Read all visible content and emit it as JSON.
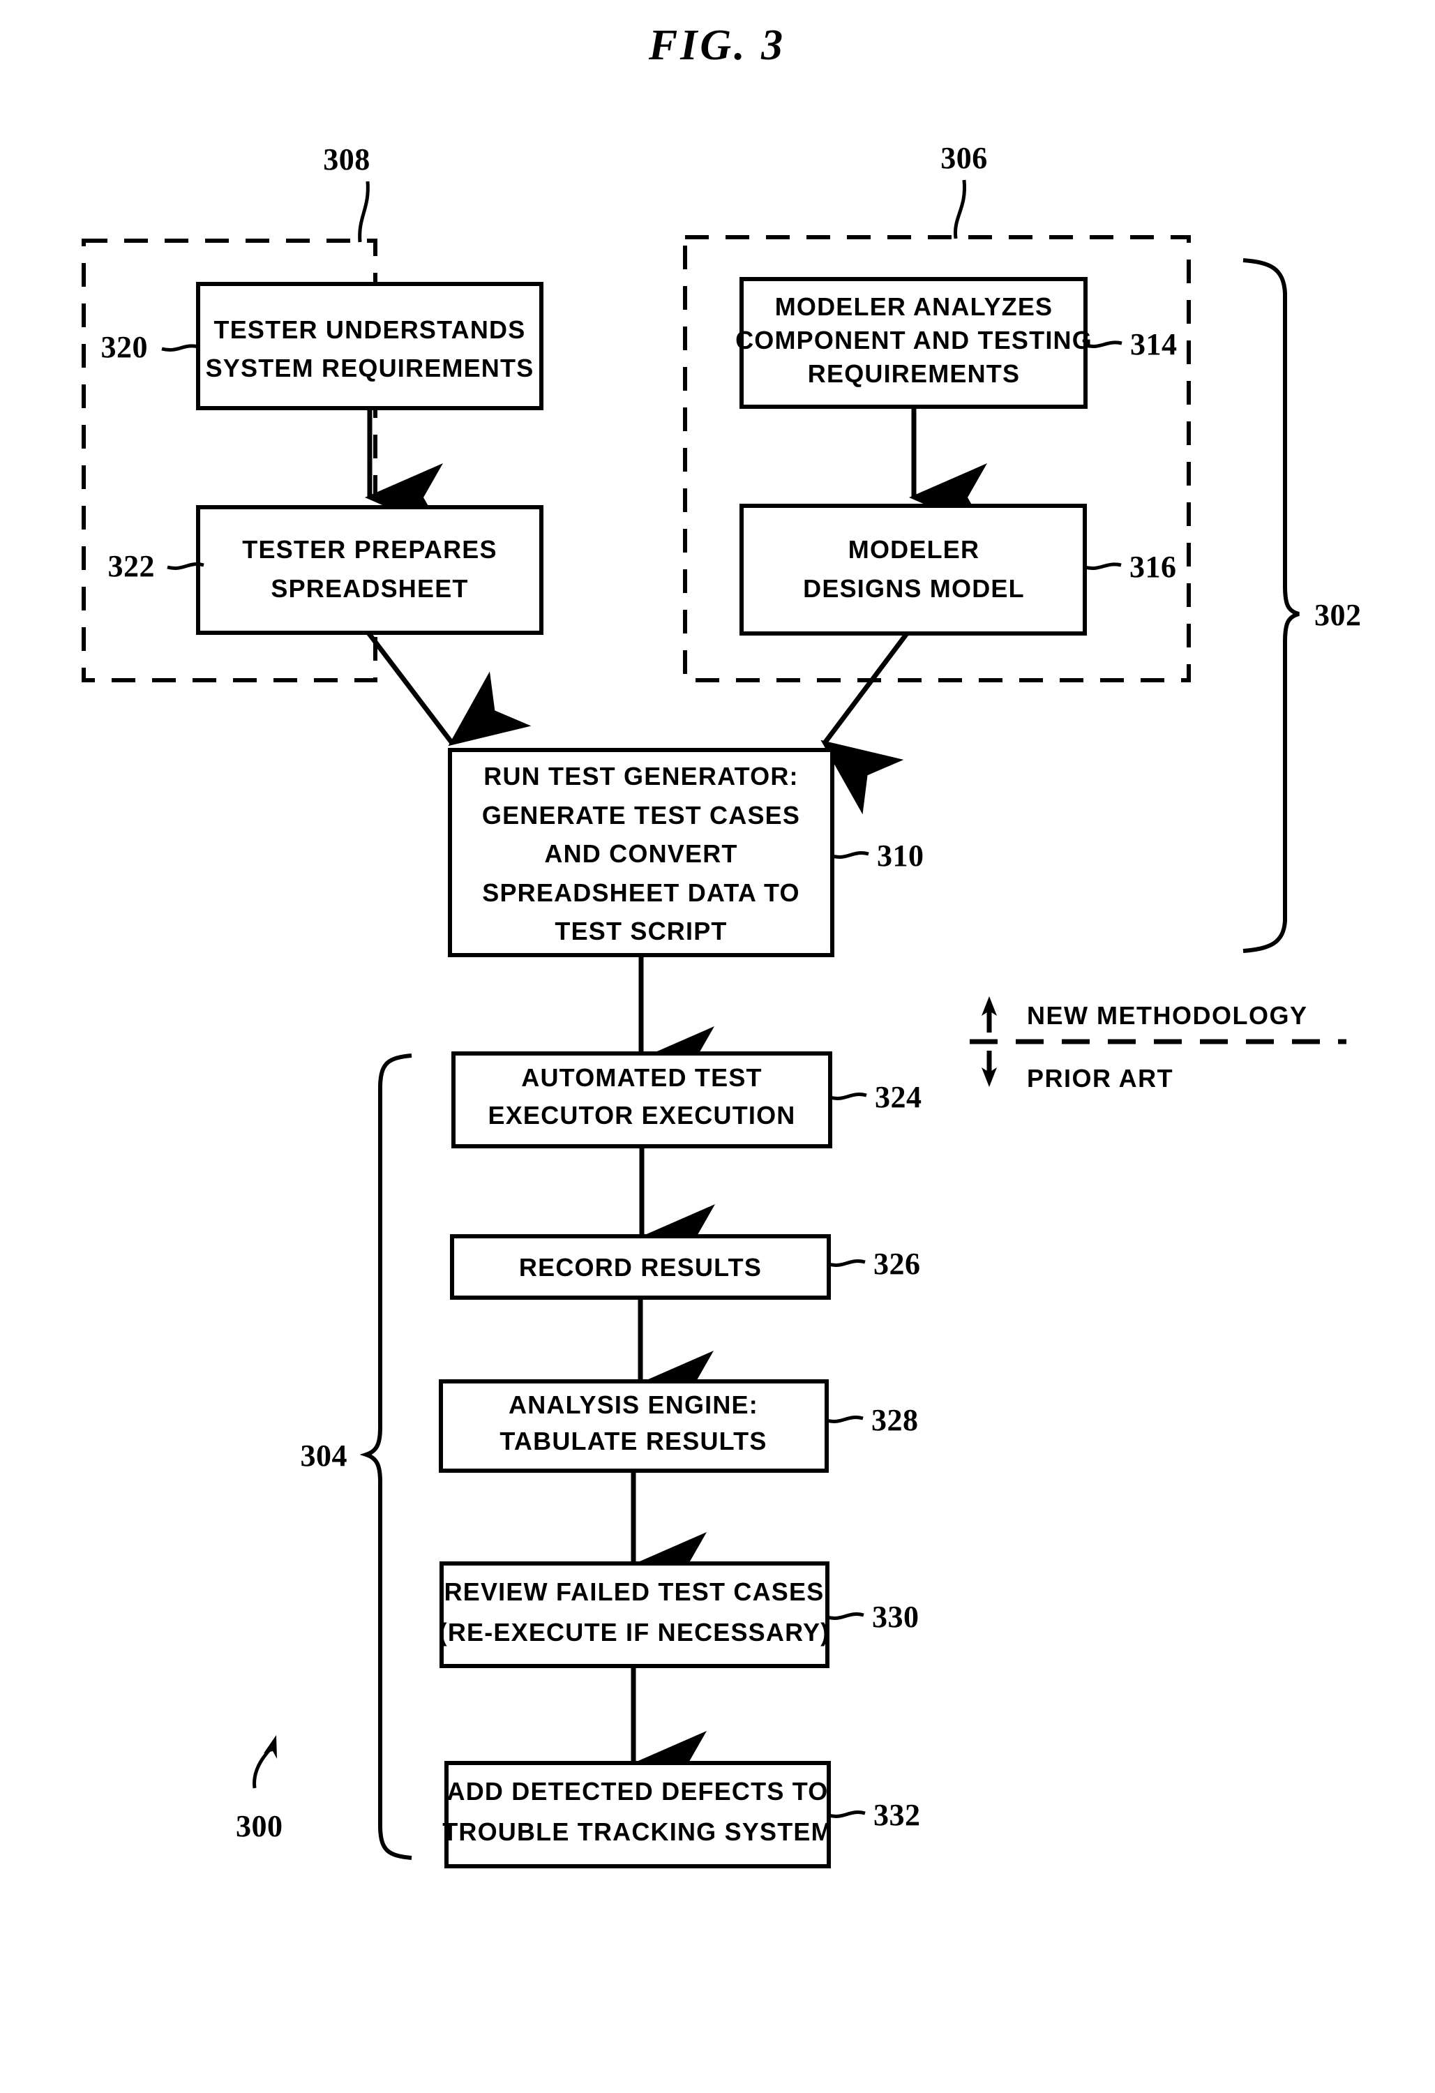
{
  "figure": {
    "title": "FIG.  3",
    "root_reference": "300"
  },
  "groups": [
    {
      "id": "tester-group",
      "reference": "308",
      "name": "tester-dashed-group"
    },
    {
      "id": "modeler-group",
      "reference": "306",
      "name": "modeler-dashed-group"
    }
  ],
  "braces": [
    {
      "id": "brace-302",
      "reference": "302",
      "name": "new-methodology-brace"
    },
    {
      "id": "brace-304",
      "reference": "304",
      "name": "prior-art-brace"
    }
  ],
  "boxes": [
    {
      "id": "box-320",
      "reference": "320",
      "lines": [
        "TESTER UNDERSTANDS",
        "SYSTEM REQUIREMENTS"
      ],
      "line1": "TESTER UNDERSTANDS",
      "line2": "SYSTEM REQUIREMENTS",
      "line3": "",
      "line4": "",
      "line5": ""
    },
    {
      "id": "box-314",
      "reference": "314",
      "lines": [
        "MODELER ANALYZES",
        "COMPONENT AND TESTING",
        "REQUIREMENTS"
      ],
      "line1": "MODELER ANALYZES",
      "line2": "COMPONENT AND TESTING",
      "line3": "REQUIREMENTS",
      "line4": "",
      "line5": ""
    },
    {
      "id": "box-322",
      "reference": "322",
      "lines": [
        "TESTER PREPARES",
        "SPREADSHEET"
      ],
      "line1": "TESTER PREPARES",
      "line2": "SPREADSHEET",
      "line3": "",
      "line4": "",
      "line5": ""
    },
    {
      "id": "box-316",
      "reference": "316",
      "lines": [
        "MODELER",
        "DESIGNS MODEL"
      ],
      "line1": "MODELER",
      "line2": "DESIGNS MODEL",
      "line3": "",
      "line4": "",
      "line5": ""
    },
    {
      "id": "box-310",
      "reference": "310",
      "lines": [
        "RUN TEST GENERATOR:",
        "GENERATE TEST CASES",
        "AND CONVERT",
        "SPREADSHEET DATA TO",
        "TEST SCRIPT"
      ],
      "line1": "RUN TEST GENERATOR:",
      "line2": "GENERATE TEST CASES",
      "line3": "AND CONVERT",
      "line4": "SPREADSHEET DATA TO",
      "line5": "TEST SCRIPT"
    },
    {
      "id": "box-324",
      "reference": "324",
      "lines": [
        "AUTOMATED TEST",
        "EXECUTOR EXECUTION"
      ],
      "line1": "AUTOMATED TEST",
      "line2": "EXECUTOR EXECUTION",
      "line3": "",
      "line4": "",
      "line5": ""
    },
    {
      "id": "box-326",
      "reference": "326",
      "lines": [
        "RECORD RESULTS"
      ],
      "line1": "RECORD RESULTS",
      "line2": "",
      "line3": "",
      "line4": "",
      "line5": ""
    },
    {
      "id": "box-328",
      "reference": "328",
      "lines": [
        "ANALYSIS ENGINE:",
        "TABULATE RESULTS"
      ],
      "line1": "ANALYSIS ENGINE:",
      "line2": "TABULATE RESULTS",
      "line3": "",
      "line4": "",
      "line5": ""
    },
    {
      "id": "box-330",
      "reference": "330",
      "lines": [
        "REVIEW FAILED TEST CASES",
        "(RE-EXECUTE IF NECESSARY)"
      ],
      "line1": "REVIEW FAILED TEST CASES",
      "line2": "(RE-EXECUTE IF NECESSARY)",
      "line3": "",
      "line4": "",
      "line5": ""
    },
    {
      "id": "box-332",
      "reference": "332",
      "lines": [
        "ADD DETECTED DEFECTS TO",
        "TROUBLE TRACKING SYSTEM"
      ],
      "line1": "ADD DETECTED DEFECTS TO",
      "line2": "TROUBLE TRACKING SYSTEM",
      "line3": "",
      "line4": "",
      "line5": ""
    }
  ],
  "legend": {
    "new_methodology_label": "NEW METHODOLOGY",
    "prior_art_label": "PRIOR ART"
  },
  "colors": {
    "ink": "#000000",
    "paper": "#ffffff"
  }
}
